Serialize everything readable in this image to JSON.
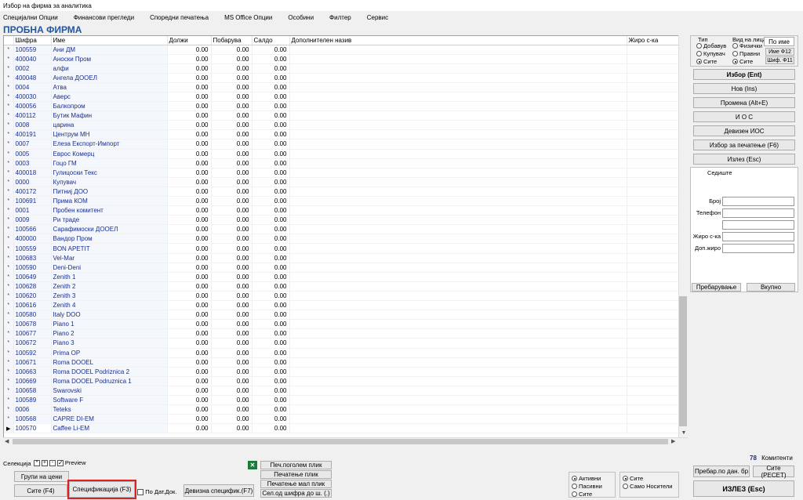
{
  "window": {
    "title": "Избор на фирма за аналитика"
  },
  "menu": [
    "Специјални Опции",
    "Финансови прегледи",
    "Споредни печатења",
    "MS Office Опции",
    "Особини",
    "Филтер",
    "Сервис"
  ],
  "header": {
    "company": "ПРОБНА ФИРМА"
  },
  "grid": {
    "columns": {
      "code": "Шифра",
      "name": "Име",
      "debit": "Должи",
      "credit": "Побарува",
      "balance": "Салдо",
      "extra": "Дополнителен назив",
      "account": "Жиро с-ка"
    },
    "rows": [
      {
        "code": "100559",
        "name": "Ани ДМ",
        "d": "0.00",
        "c": "0.00",
        "s": "0.00"
      },
      {
        "code": "400040",
        "name": "Аноски Пром",
        "d": "0.00",
        "c": "0.00",
        "s": "0.00"
      },
      {
        "code": "0002",
        "name": "алфи",
        "d": "0.00",
        "c": "0.00",
        "s": "0.00"
      },
      {
        "code": "400048",
        "name": "Ангела ДООЕЛ",
        "d": "0.00",
        "c": "0.00",
        "s": "0.00"
      },
      {
        "code": "0004",
        "name": "Атва",
        "d": "0.00",
        "c": "0.00",
        "s": "0.00"
      },
      {
        "code": "400030",
        "name": "Аверс",
        "d": "0.00",
        "c": "0.00",
        "s": "0.00"
      },
      {
        "code": "400056",
        "name": "Балкопром",
        "d": "0.00",
        "c": "0.00",
        "s": "0.00"
      },
      {
        "code": "400112",
        "name": "Бутик Мафин",
        "d": "0.00",
        "c": "0.00",
        "s": "0.00"
      },
      {
        "code": "0008",
        "name": "царина",
        "d": "0.00",
        "c": "0.00",
        "s": "0.00"
      },
      {
        "code": "400191",
        "name": "Центрум МН",
        "d": "0.00",
        "c": "0.00",
        "s": "0.00"
      },
      {
        "code": "0007",
        "name": "Елеза Експорт-Импорт",
        "d": "0.00",
        "c": "0.00",
        "s": "0.00"
      },
      {
        "code": "0005",
        "name": "Еврос Комерц",
        "d": "0.00",
        "c": "0.00",
        "s": "0.00"
      },
      {
        "code": "0003",
        "name": "Гоцо ГМ",
        "d": "0.00",
        "c": "0.00",
        "s": "0.00"
      },
      {
        "code": "400018",
        "name": "Гулицоски Текс",
        "d": "0.00",
        "c": "0.00",
        "s": "0.00"
      },
      {
        "code": "0000",
        "name": "Купувач",
        "d": "0.00",
        "c": "0.00",
        "s": "0.00"
      },
      {
        "code": "400172",
        "name": "Питниј ДОО",
        "d": "0.00",
        "c": "0.00",
        "s": "0.00"
      },
      {
        "code": "100691",
        "name": "Прима КОМ",
        "d": "0.00",
        "c": "0.00",
        "s": "0.00"
      },
      {
        "code": "0001",
        "name": "Пробен комитент",
        "d": "0.00",
        "c": "0.00",
        "s": "0.00"
      },
      {
        "code": "0009",
        "name": "Ри траде",
        "d": "0.00",
        "c": "0.00",
        "s": "0.00"
      },
      {
        "code": "100566",
        "name": "Сарафимоски ДООЕЛ",
        "d": "0.00",
        "c": "0.00",
        "s": "0.00"
      },
      {
        "code": "400000",
        "name": "Вандор Пром",
        "d": "0.00",
        "c": "0.00",
        "s": "0.00"
      },
      {
        "code": "100559",
        "name": "BON APETIT",
        "d": "0.00",
        "c": "0.00",
        "s": "0.00"
      },
      {
        "code": "100683",
        "name": "Vel-Mar",
        "d": "0.00",
        "c": "0.00",
        "s": "0.00"
      },
      {
        "code": "100590",
        "name": "Deni-Deni",
        "d": "0.00",
        "c": "0.00",
        "s": "0.00"
      },
      {
        "code": "100649",
        "name": "Zenith 1",
        "d": "0.00",
        "c": "0.00",
        "s": "0.00"
      },
      {
        "code": "100628",
        "name": "Zenith 2",
        "d": "0.00",
        "c": "0.00",
        "s": "0.00"
      },
      {
        "code": "100620",
        "name": "Zenith 3",
        "d": "0.00",
        "c": "0.00",
        "s": "0.00"
      },
      {
        "code": "100616",
        "name": "Zenith 4",
        "d": "0.00",
        "c": "0.00",
        "s": "0.00"
      },
      {
        "code": "100580",
        "name": "Italy DOO",
        "d": "0.00",
        "c": "0.00",
        "s": "0.00"
      },
      {
        "code": "100678",
        "name": "Piano 1",
        "d": "0.00",
        "c": "0.00",
        "s": "0.00"
      },
      {
        "code": "100677",
        "name": "Piano 2",
        "d": "0.00",
        "c": "0.00",
        "s": "0.00"
      },
      {
        "code": "100672",
        "name": "Piano 3",
        "d": "0.00",
        "c": "0.00",
        "s": "0.00"
      },
      {
        "code": "100592",
        "name": "Prima OP",
        "d": "0.00",
        "c": "0.00",
        "s": "0.00"
      },
      {
        "code": "100671",
        "name": "Roma DOOEL",
        "d": "0.00",
        "c": "0.00",
        "s": "0.00"
      },
      {
        "code": "100663",
        "name": "Roma DOOEL Podriznica 2",
        "d": "0.00",
        "c": "0.00",
        "s": "0.00"
      },
      {
        "code": "100669",
        "name": "Roma DOOEL Podruznica 1",
        "d": "0.00",
        "c": "0.00",
        "s": "0.00"
      },
      {
        "code": "100658",
        "name": "Swarovski",
        "d": "0.00",
        "c": "0.00",
        "s": "0.00"
      },
      {
        "code": "100589",
        "name": "Software F",
        "d": "0.00",
        "c": "0.00",
        "s": "0.00"
      },
      {
        "code": "0006",
        "name": "Teteks",
        "d": "0.00",
        "c": "0.00",
        "s": "0.00"
      },
      {
        "code": "100568",
        "name": "CAPRE DI-EM",
        "d": "0.00",
        "c": "0.00",
        "s": "0.00"
      },
      {
        "code": "100570",
        "name": "Caffee Li-EM",
        "d": "0.00",
        "c": "0.00",
        "s": "0.00"
      }
    ]
  },
  "right": {
    "type_label": "Тип",
    "type_options": [
      "Добавув",
      "Купувач",
      "Сите"
    ],
    "type_selected": 2,
    "person_label": "Вид на лица",
    "person_options": [
      "Физички",
      "Правни",
      "Сите"
    ],
    "person_selected": 2,
    "by_name": "По име",
    "name_f12": "Име Ф12",
    "code_f11": "Шиф. Ф11",
    "buttons": [
      "Избор (Ent)",
      "Нов (Ins)",
      "Промена (Alt+E)",
      "И О С",
      "Девизен ИОС",
      "Избор за печатење (F6)",
      "Излез (Esc)"
    ],
    "seat_label": "Седиште",
    "fields": [
      "Број",
      "Телефон",
      "",
      "Жиро с-ка",
      "Доп.жиро"
    ],
    "search": "Пребарување",
    "total": "Вкупно"
  },
  "bottom": {
    "selection_label": "Селекција",
    "preview": "Preview",
    "groups": "Групи на цени",
    "all_f4": "Сите (F4)",
    "spec_f3": "Спецификација (F3)",
    "by_date": "По Дат.Док.",
    "fx_spec": "Девизна специфик.(F7)",
    "print_large": "Печ.поголем плик",
    "print_env": "Печатење плик",
    "print_small": "Печатење мал плик",
    "sel_code": "Сел.од шифра до ш. (.)",
    "status_opts": [
      "Активни",
      "Пасивни",
      "Сите"
    ],
    "status_selected": 0,
    "carrier_opts": [
      "Сите",
      "Само Носители"
    ],
    "carrier_selected": 0,
    "count": "78",
    "count_label": "Комитенти",
    "search_date": "Пребар.по дан. бр",
    "all_reset": "Сите (РЕСЕТ)",
    "exit": "ИЗЛЕЗ   (Esc)"
  }
}
